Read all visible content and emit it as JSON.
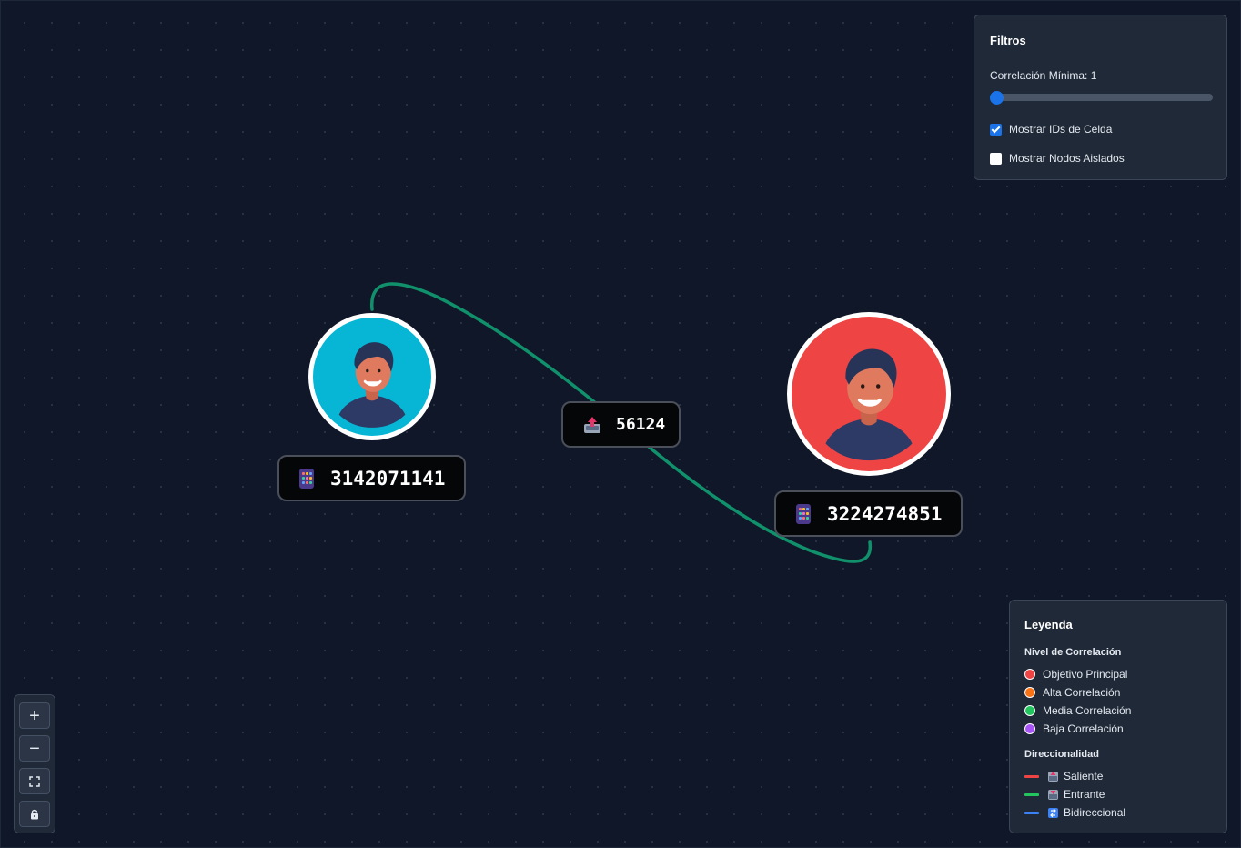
{
  "nodes": [
    {
      "phone": "3142071141",
      "color": "#06b6d4",
      "role": "Media Correlación"
    },
    {
      "phone": "3224274851",
      "color": "#ef4444",
      "role": "Objetivo Principal"
    }
  ],
  "edge": {
    "cell_id": "56124",
    "color": "#10916b",
    "direction": "Entrante"
  },
  "filters": {
    "title": "Filtros",
    "corr_label": "Correlación Mínima: 1",
    "corr_value": 1,
    "show_cell_ids_label": "Mostrar IDs de Celda",
    "show_cell_ids": true,
    "show_isolated_label": "Mostrar Nodos Aislados",
    "show_isolated": false
  },
  "legend": {
    "title": "Leyenda",
    "level_section": "Nivel de Correlación",
    "levels": [
      {
        "label": "Objetivo Principal",
        "color": "#ef4444"
      },
      {
        "label": "Alta Correlación",
        "color": "#f97316"
      },
      {
        "label": "Media Correlación",
        "color": "#22c55e"
      },
      {
        "label": "Baja Correlación",
        "color": "#a855f7"
      }
    ],
    "direction_section": "Direccionalidad",
    "directions": [
      {
        "label": "Saliente",
        "color": "#ef4444",
        "icon": "outbox-icon"
      },
      {
        "label": "Entrante",
        "color": "#22c55e",
        "icon": "inbox-icon"
      },
      {
        "label": "Bidireccional",
        "color": "#3b82f6",
        "icon": "arrows-icon"
      }
    ]
  },
  "controls": {
    "zoom_in": "+",
    "zoom_out": "−",
    "icons": [
      "plus-icon",
      "minus-icon",
      "fit-view-icon",
      "lock-icon"
    ]
  }
}
